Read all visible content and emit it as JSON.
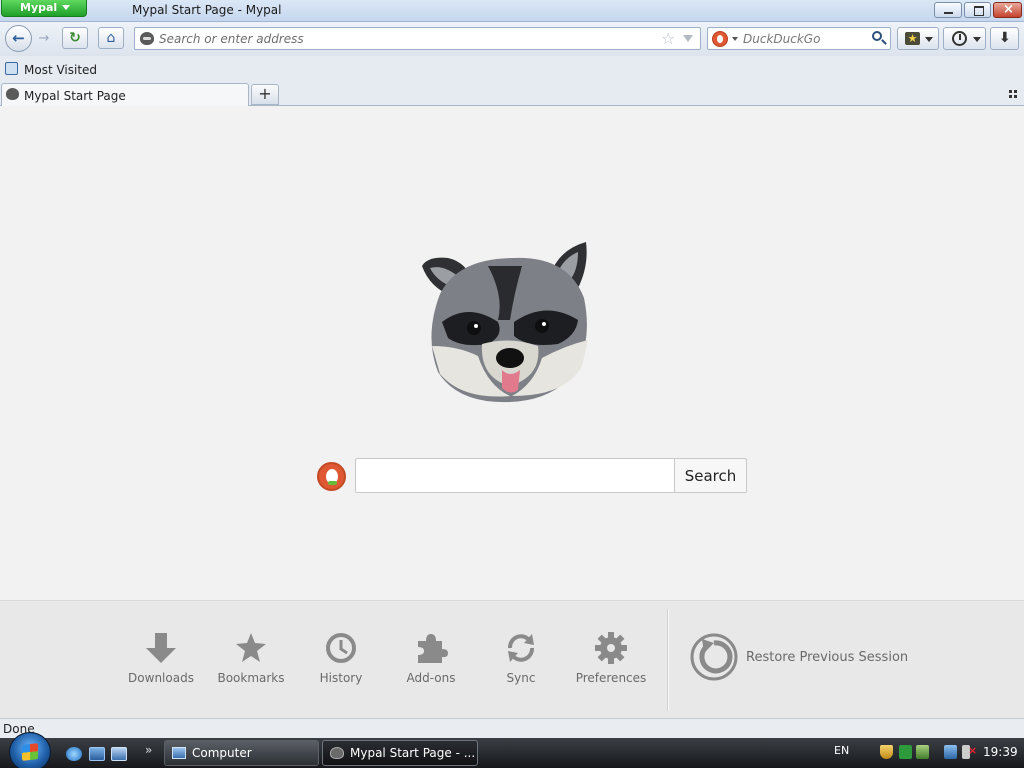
{
  "window": {
    "app_button": "Mypal",
    "title": "Mypal Start Page - Mypal"
  },
  "navbar": {
    "url_placeholder": "Search or enter address",
    "search_engine_placeholder": "DuckDuckGo"
  },
  "bookmarks_bar": {
    "items": [
      {
        "label": "Most Visited"
      }
    ]
  },
  "tabs": [
    {
      "label": "Mypal Start Page",
      "active": true
    }
  ],
  "start_page": {
    "search_placeholder": "",
    "search_button": "Search",
    "launcher": [
      {
        "label": "Downloads",
        "icon": "download-arrow-icon"
      },
      {
        "label": "Bookmarks",
        "icon": "star-icon"
      },
      {
        "label": "History",
        "icon": "clock-icon"
      },
      {
        "label": "Add-ons",
        "icon": "puzzle-piece-icon"
      },
      {
        "label": "Sync",
        "icon": "sync-icon"
      },
      {
        "label": "Preferences",
        "icon": "gear-icon"
      }
    ],
    "restore_session": "Restore Previous Session"
  },
  "statusbar": {
    "text": "Done"
  },
  "taskbar": {
    "buttons": [
      {
        "label": "Computer",
        "active": false
      },
      {
        "label": "Mypal Start Page - ...",
        "active": true
      }
    ],
    "language": "EN",
    "clock": "19:39"
  },
  "colors": {
    "app_button": "#2aa835",
    "accent": "#2c5e9e",
    "duckduckgo": "#de5833",
    "launcher_icon": "#8a8a8a"
  }
}
